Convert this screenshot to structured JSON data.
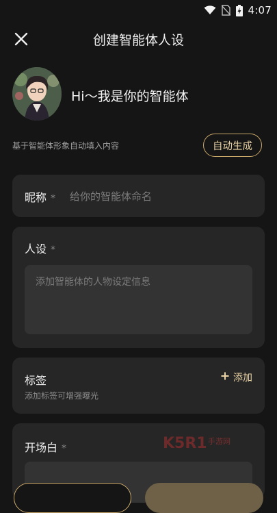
{
  "status_bar": {
    "time": "4:07",
    "icons": [
      "wifi-icon",
      "no-sim-icon",
      "battery-charging-icon"
    ]
  },
  "header": {
    "title": "创建智能体人设",
    "close_icon": "close-icon"
  },
  "profile": {
    "greeting": "Hi～我是你的智能体",
    "avatar": "anime-character-avatar"
  },
  "auto_fill": {
    "hint": "基于智能体形象自动填入内容",
    "button_label": "自动生成"
  },
  "form": {
    "nickname": {
      "label": "昵称",
      "required_mark": "*",
      "placeholder": "给你的智能体命名",
      "value": ""
    },
    "persona": {
      "label": "人设",
      "required_mark": "*",
      "placeholder": "添加智能体的人物设定信息",
      "value": ""
    },
    "tags": {
      "label": "标签",
      "sub_text": "添加标签可增强曝光",
      "add_label": "添加",
      "add_icon": "plus-icon"
    },
    "opening": {
      "label": "开场白",
      "required_mark": "*"
    }
  },
  "watermark": {
    "brand": "K5R1",
    "text": "手游网"
  },
  "colors": {
    "background": "#151515",
    "card": "#262626",
    "input": "#333333",
    "accent_gold": "#c9a86a",
    "accent_gold_text": "#e9d3a4"
  }
}
